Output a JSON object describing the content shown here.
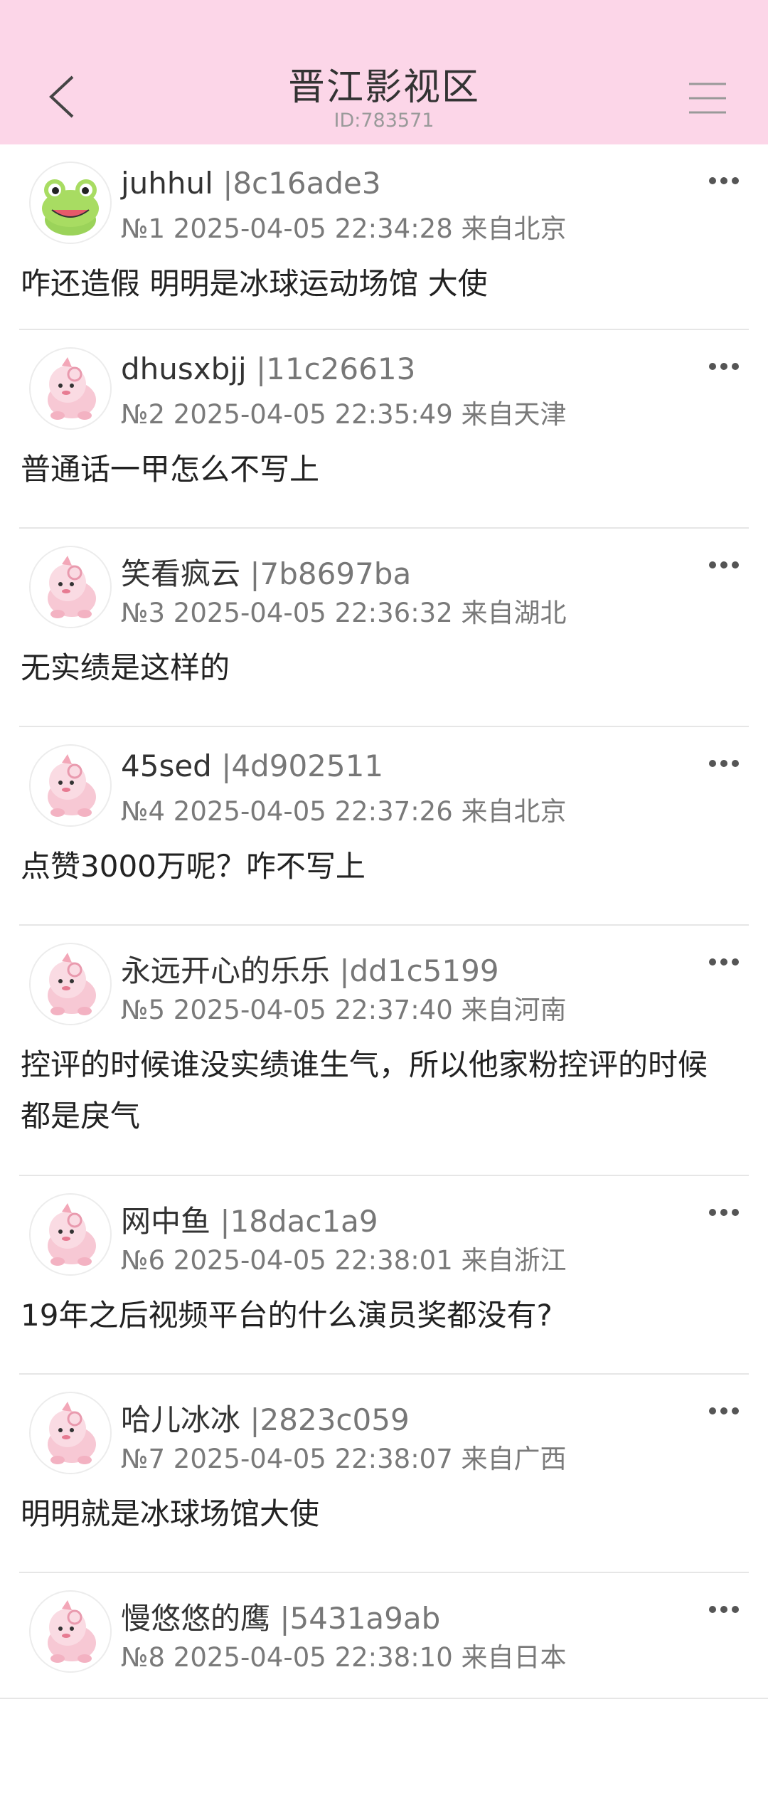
{
  "header": {
    "title": "晋江影视区",
    "subtitle": "ID:783571"
  },
  "posts": [
    {
      "name": "juhhul",
      "uid": "|8c16ade3",
      "meta": "№1 2025-04-05 22:34:28 来自北京",
      "content": "咋还造假 明明是冰球运动场馆 大使",
      "avatar": "frog-avatar"
    },
    {
      "name": "dhusxbjj",
      "uid": "|11c26613",
      "meta": "№2 2025-04-05 22:35:49 来自天津",
      "content": "普通话一甲怎么不写上",
      "avatar": "pig-avatar"
    },
    {
      "name": "笑看疯云",
      "uid": "|7b8697ba",
      "meta": "№3 2025-04-05 22:36:32 来自湖北",
      "content": "无实绩是这样的",
      "avatar": "pig-avatar"
    },
    {
      "name": "45sed",
      "uid": "|4d902511",
      "meta": "№4 2025-04-05 22:37:26 来自北京",
      "content": "点赞3000万呢？咋不写上",
      "avatar": "pig-avatar"
    },
    {
      "name": "永远开心的乐乐",
      "uid": "|dd1c5199",
      "meta": "№5 2025-04-05 22:37:40 来自河南",
      "content": "控评的时候谁没实绩谁生气，所以他家粉控评的时候都是戾气",
      "avatar": "pig-avatar"
    },
    {
      "name": "网中鱼",
      "uid": "|18dac1a9",
      "meta": "№6 2025-04-05 22:38:01 来自浙江",
      "content": "19年之后视频平台的什么演员奖都没有?",
      "avatar": "pig-avatar"
    },
    {
      "name": "哈儿冰冰",
      "uid": "|2823c059",
      "meta": "№7 2025-04-05 22:38:07 来自广西",
      "content": "明明就是冰球场馆大使",
      "avatar": "pig-avatar"
    },
    {
      "name": "慢悠悠的鹰",
      "uid": "|5431a9ab",
      "meta": "№8 2025-04-05 22:38:10 来自日本",
      "content": "",
      "avatar": "pig-avatar"
    }
  ]
}
